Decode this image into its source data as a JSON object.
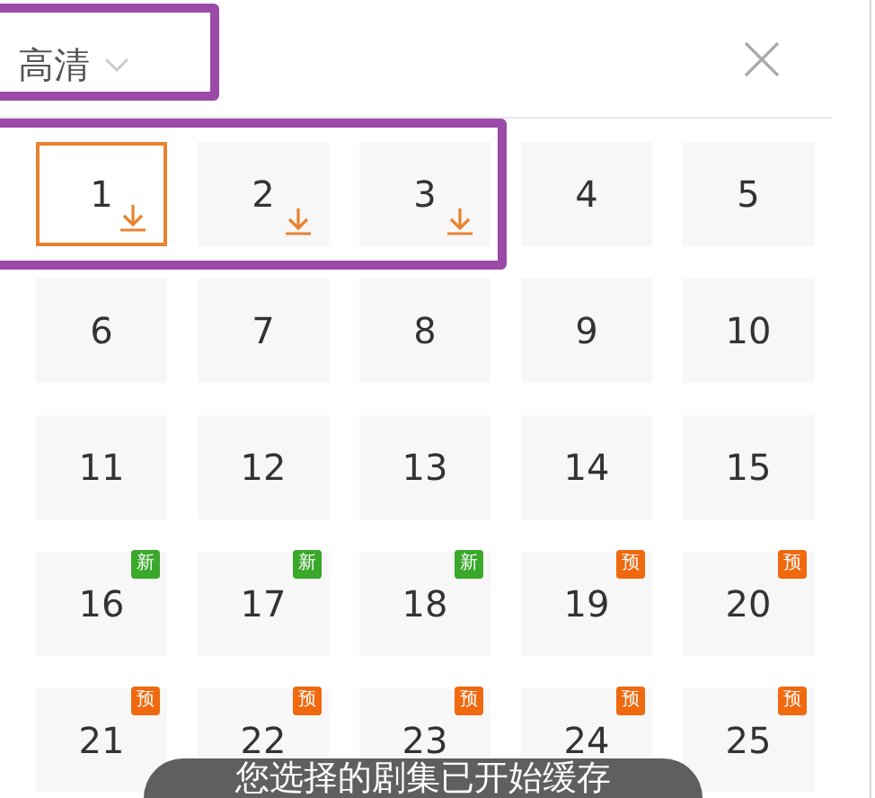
{
  "quality": {
    "label": "高清"
  },
  "episodes": [
    {
      "number": "1",
      "selected": true,
      "cached": true
    },
    {
      "number": "2",
      "selected": false,
      "cached": true
    },
    {
      "number": "3",
      "selected": false,
      "cached": true
    },
    {
      "number": "4",
      "selected": false,
      "cached": false
    },
    {
      "number": "5",
      "selected": false,
      "cached": false
    },
    {
      "number": "6",
      "selected": false,
      "cached": false
    },
    {
      "number": "7",
      "selected": false,
      "cached": false
    },
    {
      "number": "8",
      "selected": false,
      "cached": false
    },
    {
      "number": "9",
      "selected": false,
      "cached": false
    },
    {
      "number": "10",
      "selected": false,
      "cached": false
    },
    {
      "number": "11",
      "selected": false,
      "cached": false
    },
    {
      "number": "12",
      "selected": false,
      "cached": false
    },
    {
      "number": "13",
      "selected": false,
      "cached": false
    },
    {
      "number": "14",
      "selected": false,
      "cached": false
    },
    {
      "number": "15",
      "selected": false,
      "cached": false
    },
    {
      "number": "16",
      "selected": false,
      "cached": false,
      "badge": {
        "text": "新",
        "color": "#3aa82a"
      }
    },
    {
      "number": "17",
      "selected": false,
      "cached": false,
      "badge": {
        "text": "新",
        "color": "#3aa82a"
      }
    },
    {
      "number": "18",
      "selected": false,
      "cached": false,
      "badge": {
        "text": "新",
        "color": "#3aa82a"
      }
    },
    {
      "number": "19",
      "selected": false,
      "cached": false,
      "badge": {
        "text": "预",
        "color": "#f0690f"
      }
    },
    {
      "number": "20",
      "selected": false,
      "cached": false,
      "badge": {
        "text": "预",
        "color": "#f0690f"
      }
    },
    {
      "number": "21",
      "selected": false,
      "cached": false,
      "badge": {
        "text": "预",
        "color": "#f0690f"
      }
    },
    {
      "number": "22",
      "selected": false,
      "cached": false,
      "badge": {
        "text": "预",
        "color": "#f0690f"
      }
    },
    {
      "number": "23",
      "selected": false,
      "cached": false,
      "badge": {
        "text": "预",
        "color": "#f0690f"
      }
    },
    {
      "number": "24",
      "selected": false,
      "cached": false,
      "badge": {
        "text": "预",
        "color": "#f0690f"
      }
    },
    {
      "number": "25",
      "selected": false,
      "cached": false,
      "badge": {
        "text": "预",
        "color": "#f0690f"
      }
    }
  ],
  "toast": {
    "message": "您选择的剧集已开始缓存"
  }
}
